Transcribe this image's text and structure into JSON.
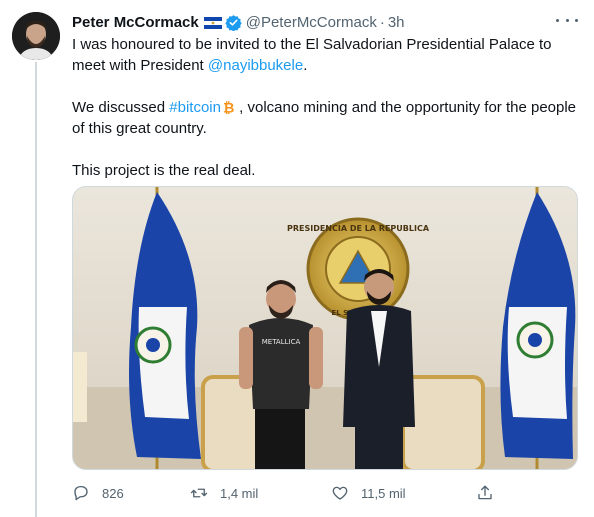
{
  "author": {
    "name": "Peter McCormack",
    "handle": "@PeterMcCormack",
    "separator": "·",
    "time": "3h",
    "flag_icon": "el-salvador-flag-icon",
    "verified_icon": "verified-badge-icon"
  },
  "tweet": {
    "p1_text": "I was honoured to be invited to the El Salvadorian Presidential Palace to meet with President ",
    "p1_mention": "@nayibbukele",
    "p1_end": ".",
    "p2_hashtag": "#bitcoin",
    "p2_rest": " , volcano mining and the opportunity for the people of this great country.",
    "p2_start": "We discussed ",
    "p3_text": "This project is the real deal."
  },
  "photo": {
    "seal_text": "PRESIDENCIA DE LA REPUBLICA",
    "seal_bottom": "EL SALVADOR",
    "shirt_text": "METALLICA"
  },
  "actions": {
    "reply_count": "826",
    "retweet_count": "1,4 mil",
    "like_count": "11,5 mil"
  },
  "colors": {
    "link": "#1d9bf0",
    "muted": "#536471",
    "flag_blue": "#0f47af",
    "bitcoin": "#f7931a"
  }
}
